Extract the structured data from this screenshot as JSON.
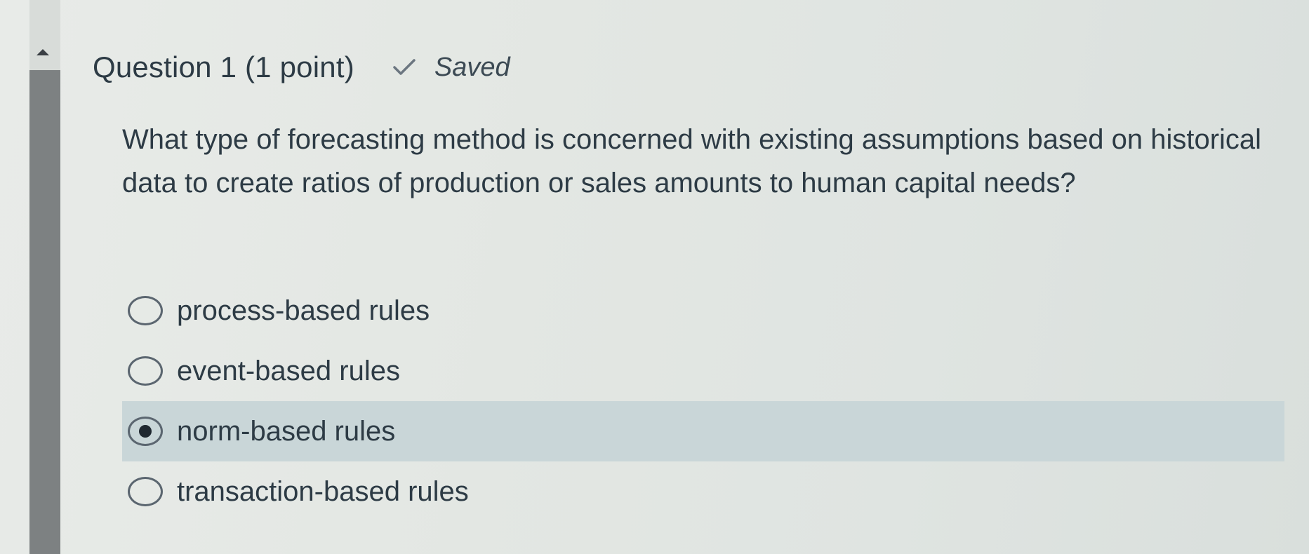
{
  "question": {
    "title": "Question 1 (1 point)",
    "status": "Saved",
    "status_icon": "check-icon",
    "text": "What type of forecasting method is concerned with existing assumptions based on historical data to create ratios of production or sales amounts to human capital needs?"
  },
  "options": [
    {
      "label": "process-based rules",
      "selected": false
    },
    {
      "label": "event-based rules",
      "selected": false
    },
    {
      "label": "norm-based rules",
      "selected": true
    },
    {
      "label": "transaction-based rules",
      "selected": false
    }
  ],
  "colors": {
    "text": "#2d3b45",
    "selected_row": "#c9d6d8",
    "scrollbar_thumb": "#7d8182"
  }
}
